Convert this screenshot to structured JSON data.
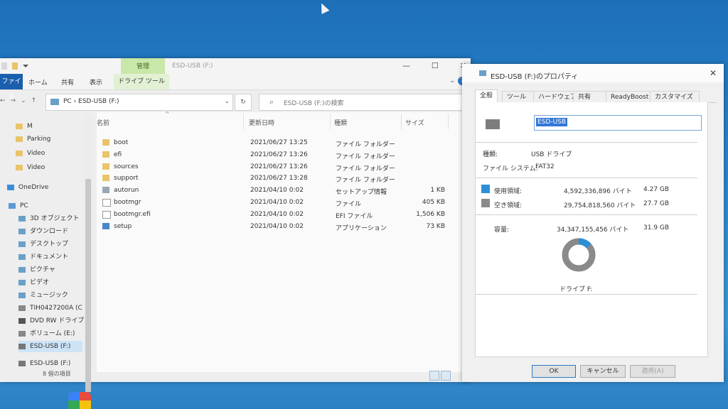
{
  "explorer": {
    "title": "ESD-USB (F:)",
    "manage_tab": "管理",
    "drive_tools_tab": "ドライブ ツール",
    "ribbon_tabs": [
      "ファイル",
      "ホーム",
      "共有",
      "表示"
    ],
    "breadcrumb": "PC  ›  ESD-USB (F:)",
    "search_placeholder": "ESD-USB (F:)の検索",
    "columns": {
      "name": "名前",
      "date": "更新日時",
      "type": "種類",
      "size": "サイズ"
    },
    "files": [
      {
        "name": "boot",
        "date": "2021/06/27 13:25",
        "type": "ファイル フォルダー",
        "size": "",
        "icon": "folder-icon"
      },
      {
        "name": "efi",
        "date": "2021/06/27 13:26",
        "type": "ファイル フォルダー",
        "size": "",
        "icon": "folder-icon"
      },
      {
        "name": "sources",
        "date": "2021/06/27 13:26",
        "type": "ファイル フォルダー",
        "size": "",
        "icon": "folder-icon"
      },
      {
        "name": "support",
        "date": "2021/06/27 13:28",
        "type": "ファイル フォルダー",
        "size": "",
        "icon": "folder-icon"
      },
      {
        "name": "autorun",
        "date": "2021/04/10 0:02",
        "type": "セットアップ情報",
        "size": "1 KB",
        "icon": "setup-info-icon"
      },
      {
        "name": "bootmgr",
        "date": "2021/04/10 0:02",
        "type": "ファイル",
        "size": "405 KB",
        "icon": "file-icon"
      },
      {
        "name": "bootmgr.efi",
        "date": "2021/04/10 0:02",
        "type": "EFI ファイル",
        "size": "1,506 KB",
        "icon": "file-icon"
      },
      {
        "name": "setup",
        "date": "2021/04/10 0:02",
        "type": "アプリケーション",
        "size": "73 KB",
        "icon": "app-icon"
      }
    ],
    "sidebar": [
      {
        "label": "M",
        "icon": "folder-icon"
      },
      {
        "label": "Parking",
        "icon": "folder-icon"
      },
      {
        "label": "Video",
        "icon": "folder-icon"
      },
      {
        "label": "Video",
        "icon": "folder-icon"
      },
      {
        "label": "OneDrive",
        "icon": "cloud-icon"
      },
      {
        "label": "PC",
        "icon": "pc-icon"
      },
      {
        "label": "3D オブジェクト",
        "icon": "3d-objects-icon"
      },
      {
        "label": "ダウンロード",
        "icon": "download-icon"
      },
      {
        "label": "デスクトップ",
        "icon": "desktop-icon"
      },
      {
        "label": "ドキュメント",
        "icon": "documents-icon"
      },
      {
        "label": "ピクチャ",
        "icon": "pictures-icon"
      },
      {
        "label": "ビデオ",
        "icon": "videos-icon"
      },
      {
        "label": "ミュージック",
        "icon": "music-icon"
      },
      {
        "label": "TIH0427200A (C",
        "icon": "drive-icon"
      },
      {
        "label": "DVD RW ドライブ",
        "icon": "dvd-icon"
      },
      {
        "label": "ボリューム (E:)",
        "icon": "drive-icon"
      },
      {
        "label": "ESD-USB (F:)",
        "icon": "usb-drive-icon"
      },
      {
        "label": "ESD-USB (F:)",
        "icon": "usb-drive-icon"
      }
    ],
    "status": "8 個の項目"
  },
  "properties": {
    "title": "ESD-USB (F:)のプロパティ",
    "tabs": [
      "全般",
      "ツール",
      "ハードウェア",
      "共有",
      "ReadyBoost",
      "カスタマイズ"
    ],
    "drive_name": "ESD-USB",
    "type_label": "種類:",
    "type_value": "USB ドライブ",
    "fs_label": "ファイル システム:",
    "fs_value": "FAT32",
    "used_label": "使用領域:",
    "used_bytes": "4,592,336,896 バイト",
    "used_gb": "4.27 GB",
    "free_label": "空き領域:",
    "free_bytes": "29,754,818,560 バイト",
    "free_gb": "27.7 GB",
    "capacity_label": "容量:",
    "capacity_bytes": "34,347,155,456 バイト",
    "capacity_gb": "31.9 GB",
    "drive_caption": "ドライブ F:",
    "used_fraction": 0.134,
    "used_color": "#2b8fd6",
    "free_color": "#8a8a8a",
    "buttons": {
      "ok": "OK",
      "cancel": "キャンセル",
      "apply": "適用(A)"
    }
  }
}
